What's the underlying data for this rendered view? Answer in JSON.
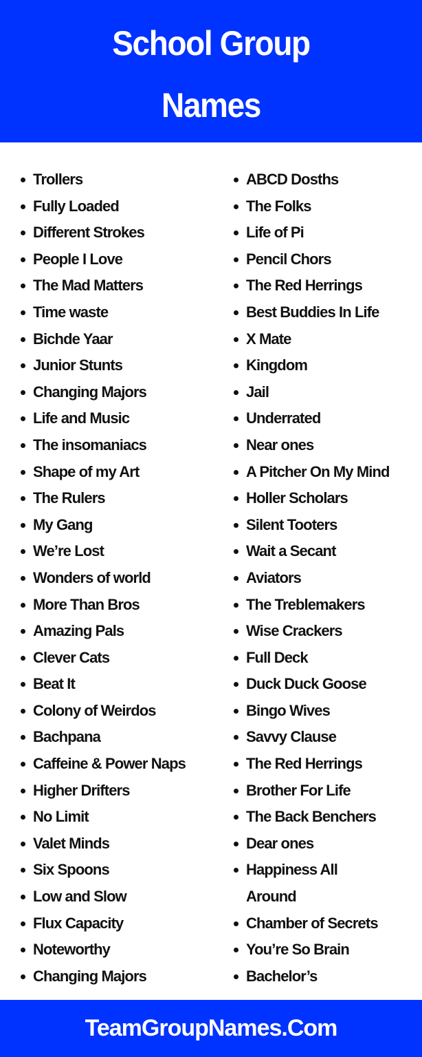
{
  "header": {
    "title_line1": "School Group",
    "title_line2": "Names"
  },
  "colors": {
    "brand_blue": "#0033ff",
    "text": "#111111",
    "background": "#ffffff"
  },
  "bullet_icon": "filled-circle",
  "lists": {
    "left": [
      "Trollers",
      "Fully Loaded",
      "Different Strokes",
      "People I Love",
      "The Mad Matters",
      "Time waste",
      "Bichde Yaar",
      "Junior Stunts",
      "Changing Majors",
      "Life and Music",
      "The insomaniacs",
      "Shape of my Art",
      "The Rulers",
      "My Gang",
      "We’re Lost",
      "Wonders of world",
      "More Than Bros",
      "Amazing Pals",
      "Clever Cats",
      "Beat It",
      "Colony of Weirdos",
      "Bachpana",
      "Caffeine & Power Naps",
      "Higher Drifters",
      "No Limit",
      "Valet Minds",
      "Six Spoons",
      "Low and Slow",
      "Flux Capacity",
      "Noteworthy",
      "Changing Majors"
    ],
    "right": [
      "ABCD Dosths",
      "The Folks",
      "Life of Pi",
      "Pencil Chors",
      "The Red Herrings",
      "Best Buddies In Life",
      "X Mate",
      "Kingdom",
      "Jail",
      "Underrated",
      "Near ones",
      "A Pitcher On My Mind",
      "Holler Scholars",
      "Silent Tooters",
      "Wait a Secant",
      "Aviators",
      "The Treblemakers",
      "Wise Crackers",
      "Full Deck",
      "Duck Duck Goose",
      "Bingo Wives",
      "Savvy Clause",
      "The Red Herrings",
      "Brother For Life",
      "The Back Benchers",
      "Dear ones",
      "Happiness All Around",
      "Chamber of Secrets",
      "You’re So Brain",
      "Bachelor’s"
    ]
  },
  "footer": {
    "site": "TeamGroupNames.Com"
  }
}
